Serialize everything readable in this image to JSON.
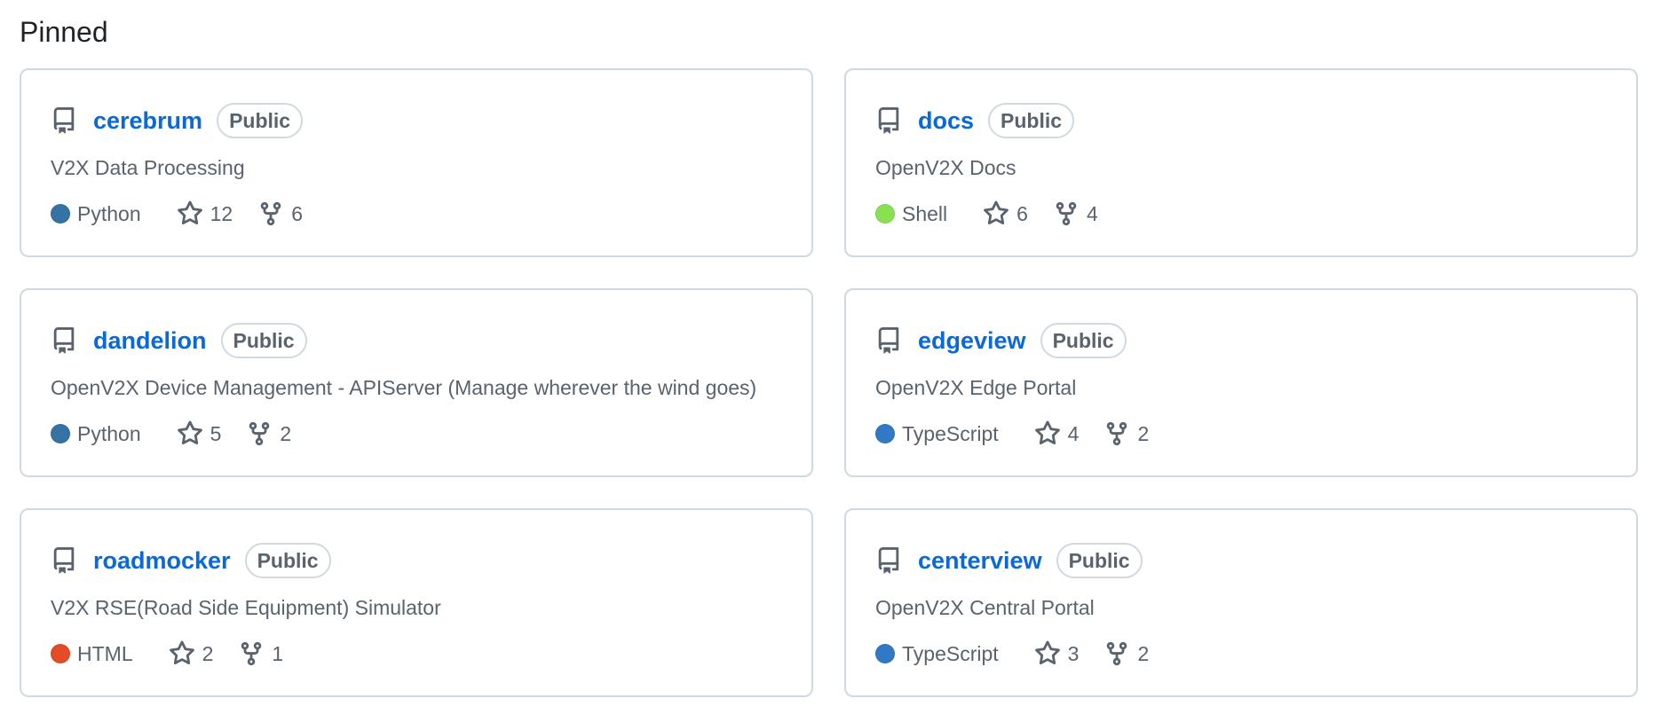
{
  "section_title": "Pinned",
  "badge_label": "Public",
  "repos": [
    {
      "name": "cerebrum",
      "description": "V2X Data Processing",
      "language": "Python",
      "language_color": "#3572A5",
      "stars": "12",
      "forks": "6"
    },
    {
      "name": "docs",
      "description": "OpenV2X Docs",
      "language": "Shell",
      "language_color": "#89e051",
      "stars": "6",
      "forks": "4"
    },
    {
      "name": "dandelion",
      "description": "OpenV2X Device Management - APIServer (Manage wherever the wind goes)",
      "language": "Python",
      "language_color": "#3572A5",
      "stars": "5",
      "forks": "2"
    },
    {
      "name": "edgeview",
      "description": "OpenV2X Edge Portal",
      "language": "TypeScript",
      "language_color": "#3178c6",
      "stars": "4",
      "forks": "2"
    },
    {
      "name": "roadmocker",
      "description": "V2X RSE(Road Side Equipment) Simulator",
      "language": "HTML",
      "language_color": "#e34c26",
      "stars": "2",
      "forks": "1"
    },
    {
      "name": "centerview",
      "description": "OpenV2X Central Portal",
      "language": "TypeScript",
      "language_color": "#3178c6",
      "stars": "3",
      "forks": "2"
    }
  ],
  "icons": {
    "repo": "repo-icon",
    "star": "star-icon",
    "fork": "fork-icon"
  }
}
